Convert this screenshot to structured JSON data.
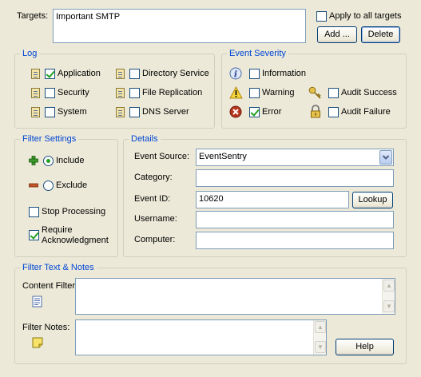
{
  "targets": {
    "label": "Targets:",
    "value": "Important SMTP",
    "apply_all_label": "Apply to all targets",
    "apply_all_checked": false,
    "add_label": "Add ...",
    "delete_label": "Delete"
  },
  "log": {
    "title": "Log",
    "items": [
      {
        "label": "Application",
        "checked": true
      },
      {
        "label": "Security",
        "checked": false
      },
      {
        "label": "System",
        "checked": false
      },
      {
        "label": "Directory Service",
        "checked": false
      },
      {
        "label": "File Replication",
        "checked": false
      },
      {
        "label": "DNS Server",
        "checked": false
      }
    ]
  },
  "severity": {
    "title": "Event Severity",
    "items": [
      {
        "label": "Information",
        "checked": false,
        "icon": "info-icon"
      },
      {
        "label": "Warning",
        "checked": false,
        "icon": "warning-icon"
      },
      {
        "label": "Error",
        "checked": true,
        "icon": "error-icon"
      },
      {
        "label": "Audit Success",
        "checked": false,
        "icon": "key-icon"
      },
      {
        "label": "Audit Failure",
        "checked": false,
        "icon": "lock-icon"
      }
    ]
  },
  "filter_settings": {
    "title": "Filter Settings",
    "include_label": "Include",
    "exclude_label": "Exclude",
    "selected": "include",
    "stop_processing_label": "Stop Processing",
    "stop_processing_checked": false,
    "require_ack_label_1": "Require",
    "require_ack_label_2": "Acknowledgment",
    "require_ack_checked": true
  },
  "details": {
    "title": "Details",
    "event_source_label": "Event Source:",
    "event_source_value": "EventSentry",
    "category_label": "Category:",
    "category_value": "",
    "event_id_label": "Event ID:",
    "event_id_value": "10620",
    "lookup_label": "Lookup",
    "username_label": "Username:",
    "username_value": "",
    "computer_label": "Computer:",
    "computer_value": ""
  },
  "notes": {
    "title": "Filter Text & Notes",
    "content_filter_label": "Content Filter:",
    "content_filter_value": "",
    "filter_notes_label": "Filter Notes:",
    "filter_notes_value": "",
    "help_label": "Help"
  }
}
